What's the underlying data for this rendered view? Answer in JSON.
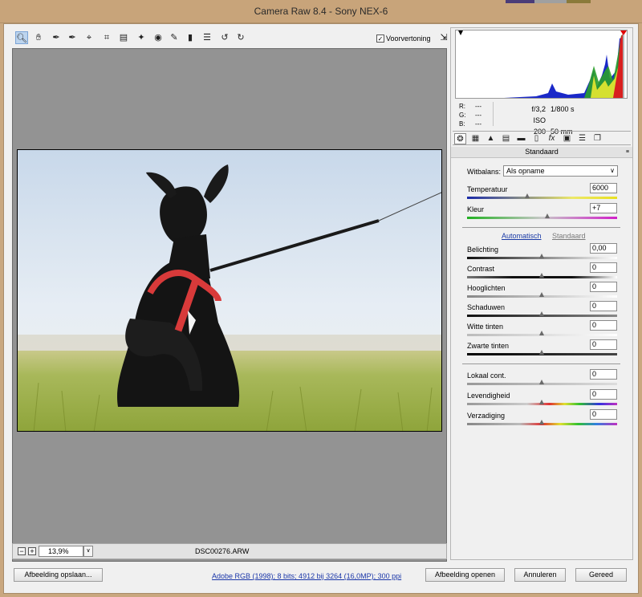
{
  "window": {
    "title": "Camera Raw 8.4  -  Sony NEX-6"
  },
  "toolbar": {
    "tools": [
      "zoom-tool-icon",
      "hand-tool-icon",
      "white-balance-tool-icon",
      "color-sampler-icon",
      "targeted-adjustment-icon",
      "crop-tool-icon",
      "straighten-tool-icon",
      "spot-removal-icon",
      "red-eye-removal-icon",
      "adjustment-brush-icon",
      "graduated-filter-icon",
      "radial-filter-icon",
      "preferences-icon",
      "rotate-left-icon",
      "rotate-right-icon"
    ],
    "preview_label": "Voorvertoning",
    "preview_checked": true
  },
  "status": {
    "zoom": "13,9%",
    "filename": "DSC00276.ARW"
  },
  "rgb": {
    "r_label": "R:",
    "r": "---",
    "g_label": "G:",
    "g": "---",
    "b_label": "B:",
    "b": "---"
  },
  "camera": {
    "aperture": "f/3,2",
    "shutter": "1/800 s",
    "iso": "ISO 200",
    "focal": "50 mm"
  },
  "panel": {
    "title": "Standaard",
    "wb_label": "Witbalans:",
    "wb_value": "Als opname",
    "temp_label": "Temperatuur",
    "temp_value": "6000",
    "tint_label": "Kleur",
    "tint_value": "+7",
    "auto_link": "Automatisch",
    "default_link": "Standaard",
    "exposure_label": "Belichting",
    "exposure_value": "0,00",
    "contrast_label": "Contrast",
    "contrast_value": "0",
    "highlights_label": "Hooglichten",
    "highlights_value": "0",
    "shadows_label": "Schaduwen",
    "shadows_value": "0",
    "whites_label": "Witte tinten",
    "whites_value": "0",
    "blacks_label": "Zwarte tinten",
    "blacks_value": "0",
    "clarity_label": "Lokaal cont.",
    "clarity_value": "0",
    "vibrance_label": "Levendigheid",
    "vibrance_value": "0",
    "saturation_label": "Verzadiging",
    "saturation_value": "0"
  },
  "footer": {
    "save_label": "Afbeelding opslaan...",
    "workflow": "Adobe RGB (1998); 8 bits; 4912 bij 3264 (16,0MP); 300 ppi",
    "open_label": "Afbeelding openen",
    "cancel_label": "Annuleren",
    "done_label": "Gereed"
  },
  "colors": {
    "accent_link": "#1a3aa6",
    "canvas_gray": "#939393",
    "title_bar": "#c8a47a"
  }
}
